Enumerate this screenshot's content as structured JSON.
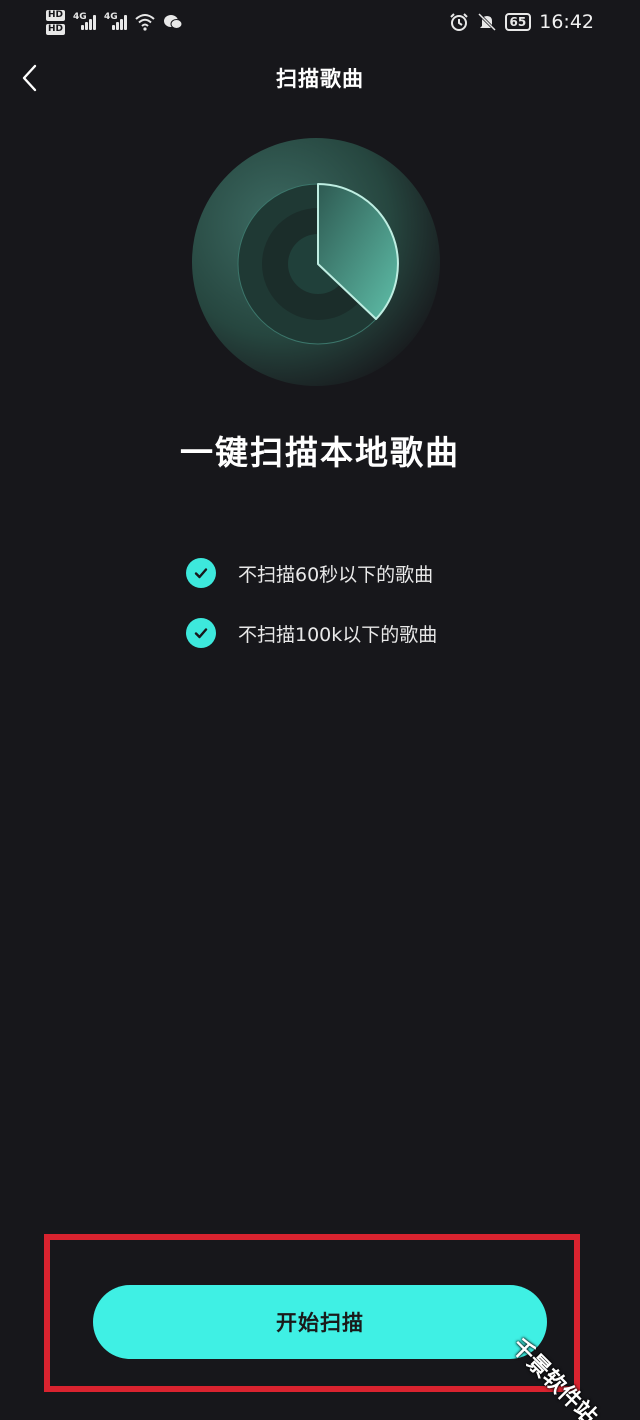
{
  "status_bar": {
    "hd_labels": [
      "HD",
      "HD"
    ],
    "network_labels": [
      "4G",
      "4G"
    ],
    "battery": "65",
    "time": "16:42",
    "icons": [
      "wifi-icon",
      "wechat-icon",
      "alarm-icon",
      "mute-icon",
      "battery-icon"
    ]
  },
  "header": {
    "back_icon": "chevron-left-icon",
    "title": "扫描歌曲"
  },
  "main": {
    "headline": "一键扫描本地歌曲",
    "rules": [
      {
        "icon": "check-icon",
        "label": "不扫描60秒以下的歌曲"
      },
      {
        "icon": "check-icon",
        "label": "不扫描100k以下的歌曲"
      }
    ]
  },
  "footer": {
    "start_button": "开始扫描"
  },
  "watermark": "千景软件站",
  "colors": {
    "background": "#17171b",
    "accent": "#3ff0e4",
    "highlight": "#d9232f"
  }
}
